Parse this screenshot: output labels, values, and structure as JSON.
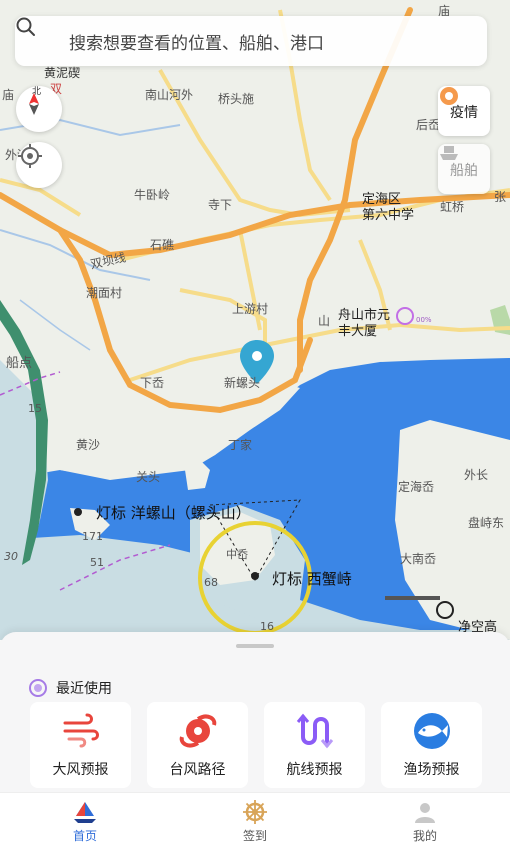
{
  "search": {
    "placeholder": "搜索想要查看的位置、船舶、港口"
  },
  "compass": {
    "north_label": "北"
  },
  "side_buttons": {
    "epidemic_label": "疫情",
    "ship_label": "船舶"
  },
  "map": {
    "labels": {
      "top_1": "庙",
      "huangni": "黄泥碶",
      "miao_left": "庙",
      "shuang": "双",
      "nanshan": "南山河外",
      "qiaotou": "桥头施",
      "houyue": "后岙",
      "waixi": "外洗",
      "niuwo": "牛卧岭",
      "sixia": "寺下",
      "dinghai_school_1": "定海区",
      "dinghai_school_2": "第六中学",
      "hongqiao": "虹桥",
      "zhang": "张",
      "shiyu": "石礁",
      "shuanghuan": "双坝线",
      "chaomian": "潮面村",
      "shangyou": "上游村",
      "zhoushan_1": "舟山市元",
      "zhoushan_2": "丰大厦",
      "shangyou_2": "山",
      "xiaao": "下岙",
      "xinluotou": "新螺头",
      "chuandian": "船点",
      "depth_15": "15",
      "huangsha": "黄沙",
      "dingjia": "丁家",
      "guantou": "关头",
      "beacon_1": "灯标 洋螺山（螺头山）",
      "depth_171": "171",
      "depth_51": "51",
      "depth_30": "30",
      "depth_68": "68",
      "zhongao": "中岙",
      "beacon_2": "灯标 西蟹峙",
      "dinghaiao": "定海岙",
      "waichang": "外长",
      "panzhi": "盘峙东",
      "danan": "大南岙",
      "jingkong": "净空高",
      "depth_16": "16",
      "pct": "00%"
    }
  },
  "panel": {
    "recent_title": "最近使用",
    "tools": [
      {
        "label": "大风预报",
        "icon": "wind-icon"
      },
      {
        "label": "台风路径",
        "icon": "typhoon-icon"
      },
      {
        "label": "航线预报",
        "icon": "route-icon"
      },
      {
        "label": "渔场预报",
        "icon": "fish-icon"
      }
    ]
  },
  "tabs": [
    {
      "label": "首页",
      "icon": "sailboat-icon"
    },
    {
      "label": "签到",
      "icon": "helm-icon"
    },
    {
      "label": "我的",
      "icon": "user-icon"
    }
  ],
  "colors": {
    "sea": "#3b86e6",
    "shallow": "#c9dde3",
    "land": "#eef0ea",
    "major_road": "#f2a646",
    "minor_road": "#f6dc8a",
    "accent_blue": "#2f6dd9",
    "tool_red": "#e8453c",
    "tool_purple": "#8b5cf6",
    "tool_blue": "#2a7de1"
  }
}
